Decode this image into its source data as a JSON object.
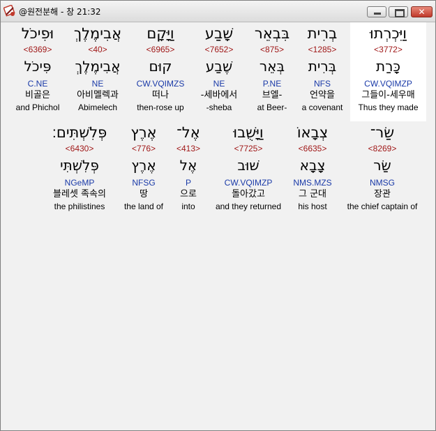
{
  "window": {
    "title": "@원전분해 - 창 21:32",
    "close_glyph": "✕"
  },
  "verse": {
    "row1": [
      {
        "hebrew": "וַיִּכְרְתוּ",
        "strong": "<3772>",
        "lemma": "כָּרַת",
        "morph": "CW.VQIMZP",
        "korean": "그들이-세우매",
        "english": "Thus they made"
      },
      {
        "hebrew": "בְרִית",
        "strong": "<1285>",
        "lemma": "בְּרִית",
        "morph": "NFS",
        "korean": "언약을",
        "english": "a covenant"
      },
      {
        "hebrew": "בִּבְאֵר",
        "strong": "<875>",
        "lemma": "בְּאֵר",
        "morph": "P.NE",
        "korean": "브엘-",
        "english": "at Beer-"
      },
      {
        "hebrew": "שָׁבַע",
        "strong": "<7652>",
        "lemma": "שֶׁבַע",
        "morph": "NE",
        "korean": "-세바에서",
        "english": "-sheba"
      },
      {
        "hebrew": "וַיָּקָם",
        "strong": "<6965>",
        "lemma": "קוּם",
        "morph": "CW.VQIMZS",
        "korean": "떠나",
        "english": "then-rose up"
      },
      {
        "hebrew": "אֲבִימֶלֶךְ",
        "strong": "<40>",
        "lemma": "אֲבִימֶלֶךְ",
        "morph": "NE",
        "korean": "아비멜렉과",
        "english": "Abimelech"
      },
      {
        "hebrew": "וּפִיכֹל",
        "strong": "<6369>",
        "lemma": "פִּיכֹל",
        "morph": "C.NE",
        "korean": "비골은",
        "english": "and Phichol"
      }
    ],
    "row2": [
      {
        "hebrew": "שַׂר־",
        "strong": "<8269>",
        "lemma": "שַׂר",
        "morph": "NMSG",
        "korean": "장관",
        "english": "the chief captain of"
      },
      {
        "hebrew": "צְבָאוֹ",
        "strong": "<6635>",
        "lemma": "צָבָא",
        "morph": "NMS.MZS",
        "korean": "그 군대",
        "english": "his host"
      },
      {
        "hebrew": "וַיָּשֻׁבוּ",
        "strong": "<7725>",
        "lemma": "שׁוּב",
        "morph": "CW.VQIMZP",
        "korean": "돌아갔고",
        "english": "and they returned"
      },
      {
        "hebrew": "אֶל־",
        "strong": "<413>",
        "lemma": "אֶל",
        "morph": "P",
        "korean": "으로",
        "english": "into"
      },
      {
        "hebrew": "אֶרֶץ",
        "strong": "<776>",
        "lemma": "אֶרֶץ",
        "morph": "NFSG",
        "korean": "땅",
        "english": "the land of"
      },
      {
        "hebrew": "פְּלִשְׁתִּים׃",
        "strong": "<6430>",
        "lemma": "פְּלִשְׁתִּי",
        "morph": "NGeMP",
        "korean": "블레셋 족속의",
        "english": "the philistines"
      }
    ]
  },
  "colors": {
    "strong_number": "#a01818",
    "morphology": "#1a3aa8",
    "highlight": "#ffffff"
  }
}
